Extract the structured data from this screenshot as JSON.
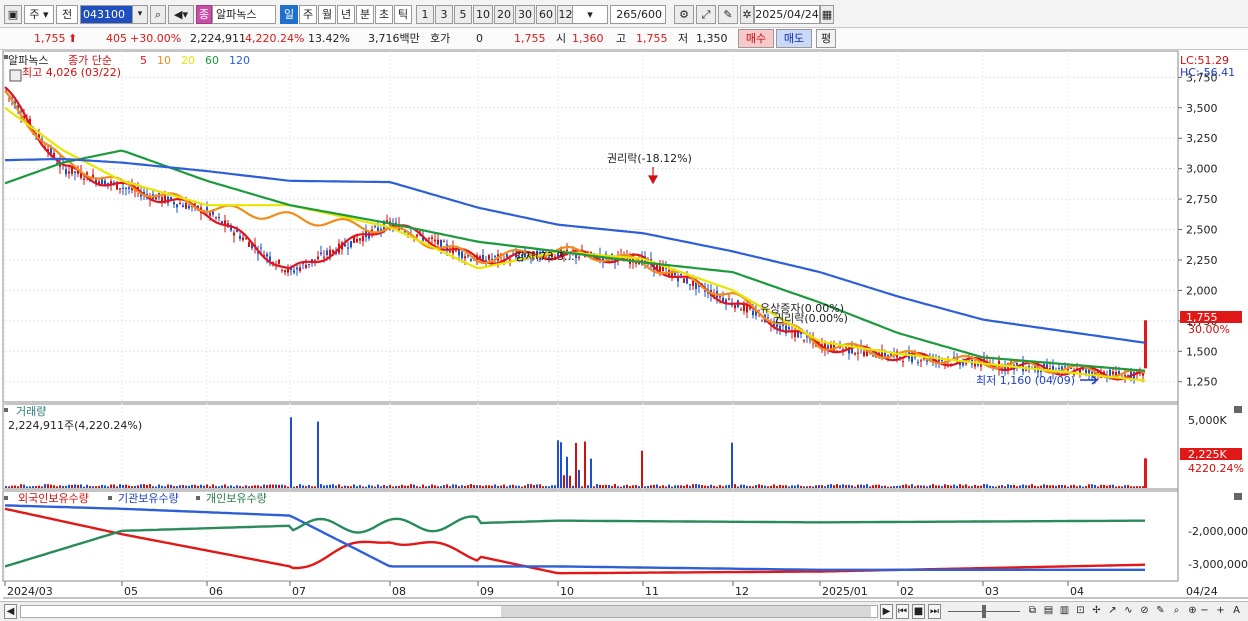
{
  "toolbar": {
    "period_main": "주",
    "prev_label": "전",
    "stock_code": "043100",
    "badge": "종",
    "stock_name": "알파녹스",
    "period_buttons": [
      "일",
      "주",
      "월",
      "년",
      "분",
      "초",
      "틱"
    ],
    "number_buttons": [
      "1",
      "3",
      "5",
      "10",
      "20",
      "30",
      "60",
      "120"
    ],
    "count": "265",
    "count_max": "/600",
    "date": "2025/04/24"
  },
  "info": {
    "price": "1,755",
    "change": "405",
    "change_pct": "+30.00%",
    "volume": "2,224,911",
    "volume_pct": "4,220.24%",
    "turnover": "13.42%",
    "amount": "3,716백만",
    "quote_label": "호가",
    "quote_value": "0",
    "quote_price": "1,755",
    "open_label": "시",
    "open": "1,360",
    "high_label": "고",
    "high": "1,755",
    "low_label": "저",
    "low": "1,350",
    "buy_button": "매수",
    "sell_button": "매도",
    "eval_button": "평"
  },
  "price_pane": {
    "legend_name": "알파녹스",
    "ma_label": "종가 단순",
    "ma_periods": [
      "5",
      "10",
      "20",
      "60",
      "120"
    ],
    "ma_colors": [
      "#e0141e",
      "#f08c1e",
      "#e6e600",
      "#1e9a3c",
      "#2e5fd6"
    ],
    "high_marker": "최고 4,026 (03/22)",
    "low_marker": "최저 1,160 (04/09)",
    "events": [
      "권리락(-18.12%)",
      "감자(73.3...",
      "유상증자(0.00%)",
      "권리락(0.00%)"
    ],
    "lc": "LC:51.29",
    "hc": "HC:-56.41",
    "last_price": "1,755",
    "last_pct": "30.00%",
    "y_ticks": [
      "3,750",
      "3,500",
      "3,250",
      "3,000",
      "2,750",
      "2,500",
      "2,250",
      "2,000",
      "1,750",
      "1,500",
      "1,250"
    ]
  },
  "volume_pane": {
    "title": "거래량",
    "value": "2,224,911주(4,220.24%)",
    "y_tick": "5,000K",
    "last_value": "2,225K",
    "last_pct": "4220.24%"
  },
  "holding_pane": {
    "foreign": "외국인보유수량",
    "institution": "기관보유수량",
    "individual": "개인보유수량",
    "y_ticks": [
      "-2,000,000",
      "-3,000,000"
    ]
  },
  "x_axis": {
    "labels": [
      "2024/03",
      "05",
      "06",
      "07",
      "08",
      "09",
      "10",
      "11",
      "12",
      "2025/01",
      "02",
      "03",
      "04"
    ],
    "right_label": "04/24"
  },
  "chart_data": [
    {
      "type": "line",
      "name": "price",
      "x": [
        "2024/03",
        "2024/04",
        "2024/05",
        "2024/06",
        "2024/07",
        "2024/08",
        "2024/09",
        "2024/10",
        "2024/11",
        "2024/12",
        "2025/01",
        "2025/02",
        "2025/03",
        "2025/04"
      ],
      "series": [
        {
          "name": "5",
          "values": [
            3650,
            3000,
            2850,
            2650,
            2150,
            2550,
            2250,
            2300,
            2250,
            1900,
            1550,
            1460,
            1400,
            1290
          ]
        },
        {
          "name": "10",
          "values": [
            3600,
            3050,
            2870,
            2680,
            2600,
            2500,
            2260,
            2330,
            2230,
            1950,
            1560,
            1470,
            1410,
            1300
          ]
        },
        {
          "name": "20",
          "values": [
            3500,
            3150,
            2900,
            2700,
            2700,
            2520,
            2180,
            2320,
            2260,
            2000,
            1580,
            1480,
            1400,
            1260
          ]
        },
        {
          "name": "60",
          "values": [
            2880,
            3050,
            3150,
            2900,
            2700,
            2550,
            2400,
            2320,
            2230,
            2150,
            1900,
            1650,
            1450,
            1340
          ]
        },
        {
          "name": "120",
          "values": [
            3070,
            3080,
            3050,
            2980,
            2900,
            2890,
            2680,
            2540,
            2470,
            2320,
            2150,
            1950,
            1760,
            1570
          ]
        }
      ],
      "ylim": [
        1100,
        3950
      ],
      "y_ticks": [
        3750,
        3500,
        3250,
        3000,
        2750,
        2500,
        2250,
        2000,
        1750,
        1500,
        1250
      ]
    },
    {
      "type": "bar",
      "name": "volume",
      "categories": [
        "2024/03",
        "2024/07",
        "2024/10",
        "2024/11",
        "2024/12",
        "2025/04"
      ],
      "values": [
        150,
        5300,
        3700,
        2800,
        3400,
        2225
      ],
      "ylim": [
        0,
        6000
      ]
    },
    {
      "type": "line",
      "name": "holdings",
      "x": [
        "2024/03",
        "2024/05",
        "2024/07",
        "2024/08",
        "2024/10",
        "2025/01",
        "2025/04"
      ],
      "series": [
        {
          "name": "외국인보유수량",
          "values": [
            -1600000,
            -2350000,
            -3300000,
            -2450000,
            -3500000,
            -3450000,
            -3250000
          ]
        },
        {
          "name": "기관보유수량",
          "values": [
            -1500000,
            -1600000,
            -1800000,
            -3300000,
            -3300000,
            -3400000,
            -3400000
          ]
        },
        {
          "name": "개인보유수량",
          "values": [
            -3300000,
            -2250000,
            -2100000,
            -2100000,
            -1950000,
            -2000000,
            -1950000
          ]
        }
      ],
      "y_ticks": [
        -2000000,
        -3000000
      ]
    }
  ]
}
